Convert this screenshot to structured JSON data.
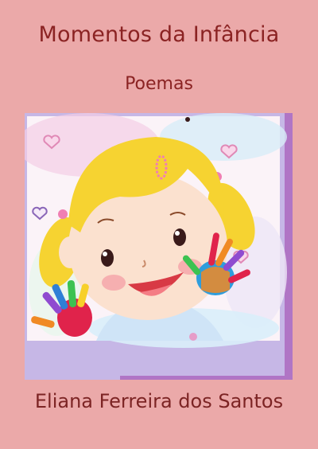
{
  "cover": {
    "title": "Momentos da Infância",
    "subtitle": "Poemas",
    "author": "Eliana Ferreira dos Santos"
  },
  "illustration": {
    "subject": "smiling-blonde-girl-with-painted-hands",
    "colors": {
      "background": "#eba9a9",
      "frame_lilac": "#c6b7e6",
      "frame_purple": "#b075c5",
      "hair": "#f6d331",
      "title_text": "#8b2323"
    }
  }
}
